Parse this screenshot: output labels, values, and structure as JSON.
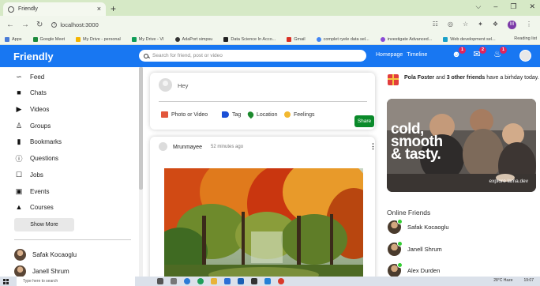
{
  "browser": {
    "tab_title": "Friendly",
    "tab_close": "×",
    "new_tab": "+",
    "window_controls": [
      "⌵",
      "–",
      "❐",
      "✕"
    ],
    "url": "localhost:3000",
    "bookmarks": [
      "Apps",
      "Google Meet",
      "My Drive - personal",
      "My Drive - VI",
      "AdaPort simpsu",
      "Data Science In Acco...",
      "Gmail",
      "complet ryele data sel...",
      "investigate Advanced...",
      "Web development sel..."
    ],
    "bookmarks_right": "Reading list",
    "profile_initial": "M"
  },
  "topbar": {
    "logo": "Friendly",
    "search_placeholder": "Search for friend, post or video",
    "links": [
      "Homepage",
      "Timeline"
    ],
    "badges": [
      "1",
      "2",
      "1"
    ]
  },
  "sidebar": {
    "items": [
      {
        "label": "Feed",
        "icon": "rss-icon"
      },
      {
        "label": "Chats",
        "icon": "chat-icon"
      },
      {
        "label": "Videos",
        "icon": "play-circle-icon"
      },
      {
        "label": "Groups",
        "icon": "group-icon"
      },
      {
        "label": "Bookmarks",
        "icon": "bookmark-icon"
      },
      {
        "label": "Questions",
        "icon": "help-circle-icon"
      },
      {
        "label": "Jobs",
        "icon": "briefcase-icon"
      },
      {
        "label": "Events",
        "icon": "calendar-icon"
      },
      {
        "label": "Courses",
        "icon": "school-icon"
      }
    ],
    "show_more": "Show More",
    "friends": [
      "Safak Kocaoglu",
      "Janell Shrum"
    ]
  },
  "share": {
    "prompt": "Hey",
    "options": [
      "Photo or Video",
      "Tag",
      "Location",
      "Feelings"
    ],
    "share_button": "Share"
  },
  "post": {
    "author": "Mrunmayee",
    "time": "52 minutes ago",
    "more": "⋮"
  },
  "rightbar": {
    "birthday_name": "Pola Foster",
    "birthday_and": " and ",
    "birthday_others": "3 other friends",
    "birthday_rest": " have a birhday today.",
    "ad_lines": [
      "cold,",
      "smooth",
      "& tasty."
    ],
    "ad_explore": "explore lama.dev",
    "online_title": "Online Friends",
    "online": [
      "Safak Kocaoglu",
      "Janell Shrum",
      "Alex Durden"
    ]
  },
  "taskbar": {
    "search": "Type here to search",
    "right": [
      "28°C Haze",
      "19:07"
    ]
  },
  "colors": {
    "brand": "#1877f2",
    "share_button": "#0a8a2a",
    "badge": "#e0245e",
    "online": "#32cd32"
  }
}
